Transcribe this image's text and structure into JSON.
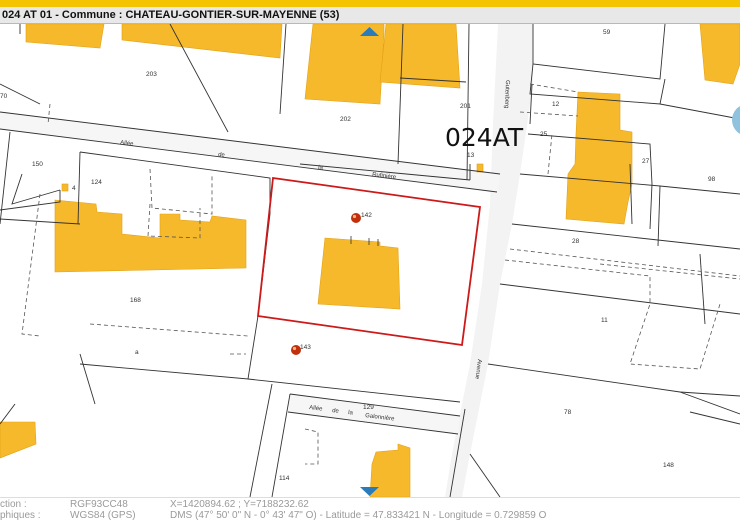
{
  "header": {
    "title": "024 AT 01 - Commune : CHATEAU-GONTIER-SUR-MAYENNE (53)"
  },
  "colors": {
    "accent_bar": "#f5c400",
    "building": "#f7b92c",
    "selected_parcel": "#cc1a1a",
    "nav_arrow": "#2b7bb9"
  },
  "map": {
    "section_label": "024AT",
    "street_labels": {
      "allee_rufiniere": [
        "Allée",
        "de",
        "la",
        "Rufinière"
      ],
      "allee_galonniere": [
        "Allée",
        "de",
        "la",
        "Galonnière"
      ],
      "avenue": "Avenue",
      "gutenberg": "Gutenberg"
    },
    "parcels": [
      "59",
      "203",
      "70",
      "201",
      "202",
      "12",
      "13",
      "25",
      "27",
      "98",
      "150",
      "124",
      "142",
      "28",
      "4",
      "168",
      "11",
      "143",
      "a",
      "129",
      "78",
      "148",
      "114"
    ],
    "markers": {
      "parcel_142": "142",
      "parcel_143": "143"
    },
    "icons": {
      "pan_up": "triangle-up-icon",
      "pan_down": "triangle-down-icon",
      "marker": "red-pin-icon"
    }
  },
  "footer": {
    "row1": {
      "label": "ction :",
      "projection": "RGF93CC48",
      "value": "X=1420894.62 ; Y=7188232.62"
    },
    "row2": {
      "label": "phiques :",
      "projection": "WGS84 (GPS)",
      "value": "DMS (47° 50' 0\" N - 0° 43' 47\" O) - Latitude = 47.833421 N - Longitude = 0.729859 O"
    }
  }
}
